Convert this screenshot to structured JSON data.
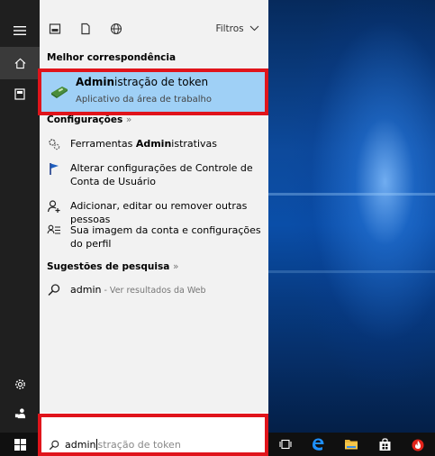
{
  "filter": {
    "label": "Filtros"
  },
  "best_match": {
    "header": "Melhor correspondência",
    "title_bold": "Admin",
    "title_rest": "istração de token",
    "subtitle": "Aplicativo da área de trabalho"
  },
  "settings": {
    "header": "Configurações",
    "more": "»",
    "items": [
      {
        "pre": "Ferramentas ",
        "bold": "Admin",
        "post": "istrativas",
        "icon": "admin-tools-icon"
      },
      {
        "text": "Alterar configurações de Controle de Conta de Usuário",
        "icon": "uac-flag-icon"
      },
      {
        "text": "Adicionar, editar ou remover outras pessoas",
        "icon": "add-person-icon"
      },
      {
        "text": "Sua imagem da conta e configurações do perfil",
        "icon": "account-picture-icon"
      }
    ]
  },
  "suggestions": {
    "header": "Sugestões de pesquisa",
    "more": "»",
    "item": {
      "text": "admin",
      "web": " - Ver resultados da Web"
    }
  },
  "search": {
    "typed": "admin",
    "ghost": "stração de token"
  },
  "colors": {
    "highlight": "#9fd0f6",
    "annotation_red": "#e0141b",
    "edge_blue": "#1e90ff"
  }
}
